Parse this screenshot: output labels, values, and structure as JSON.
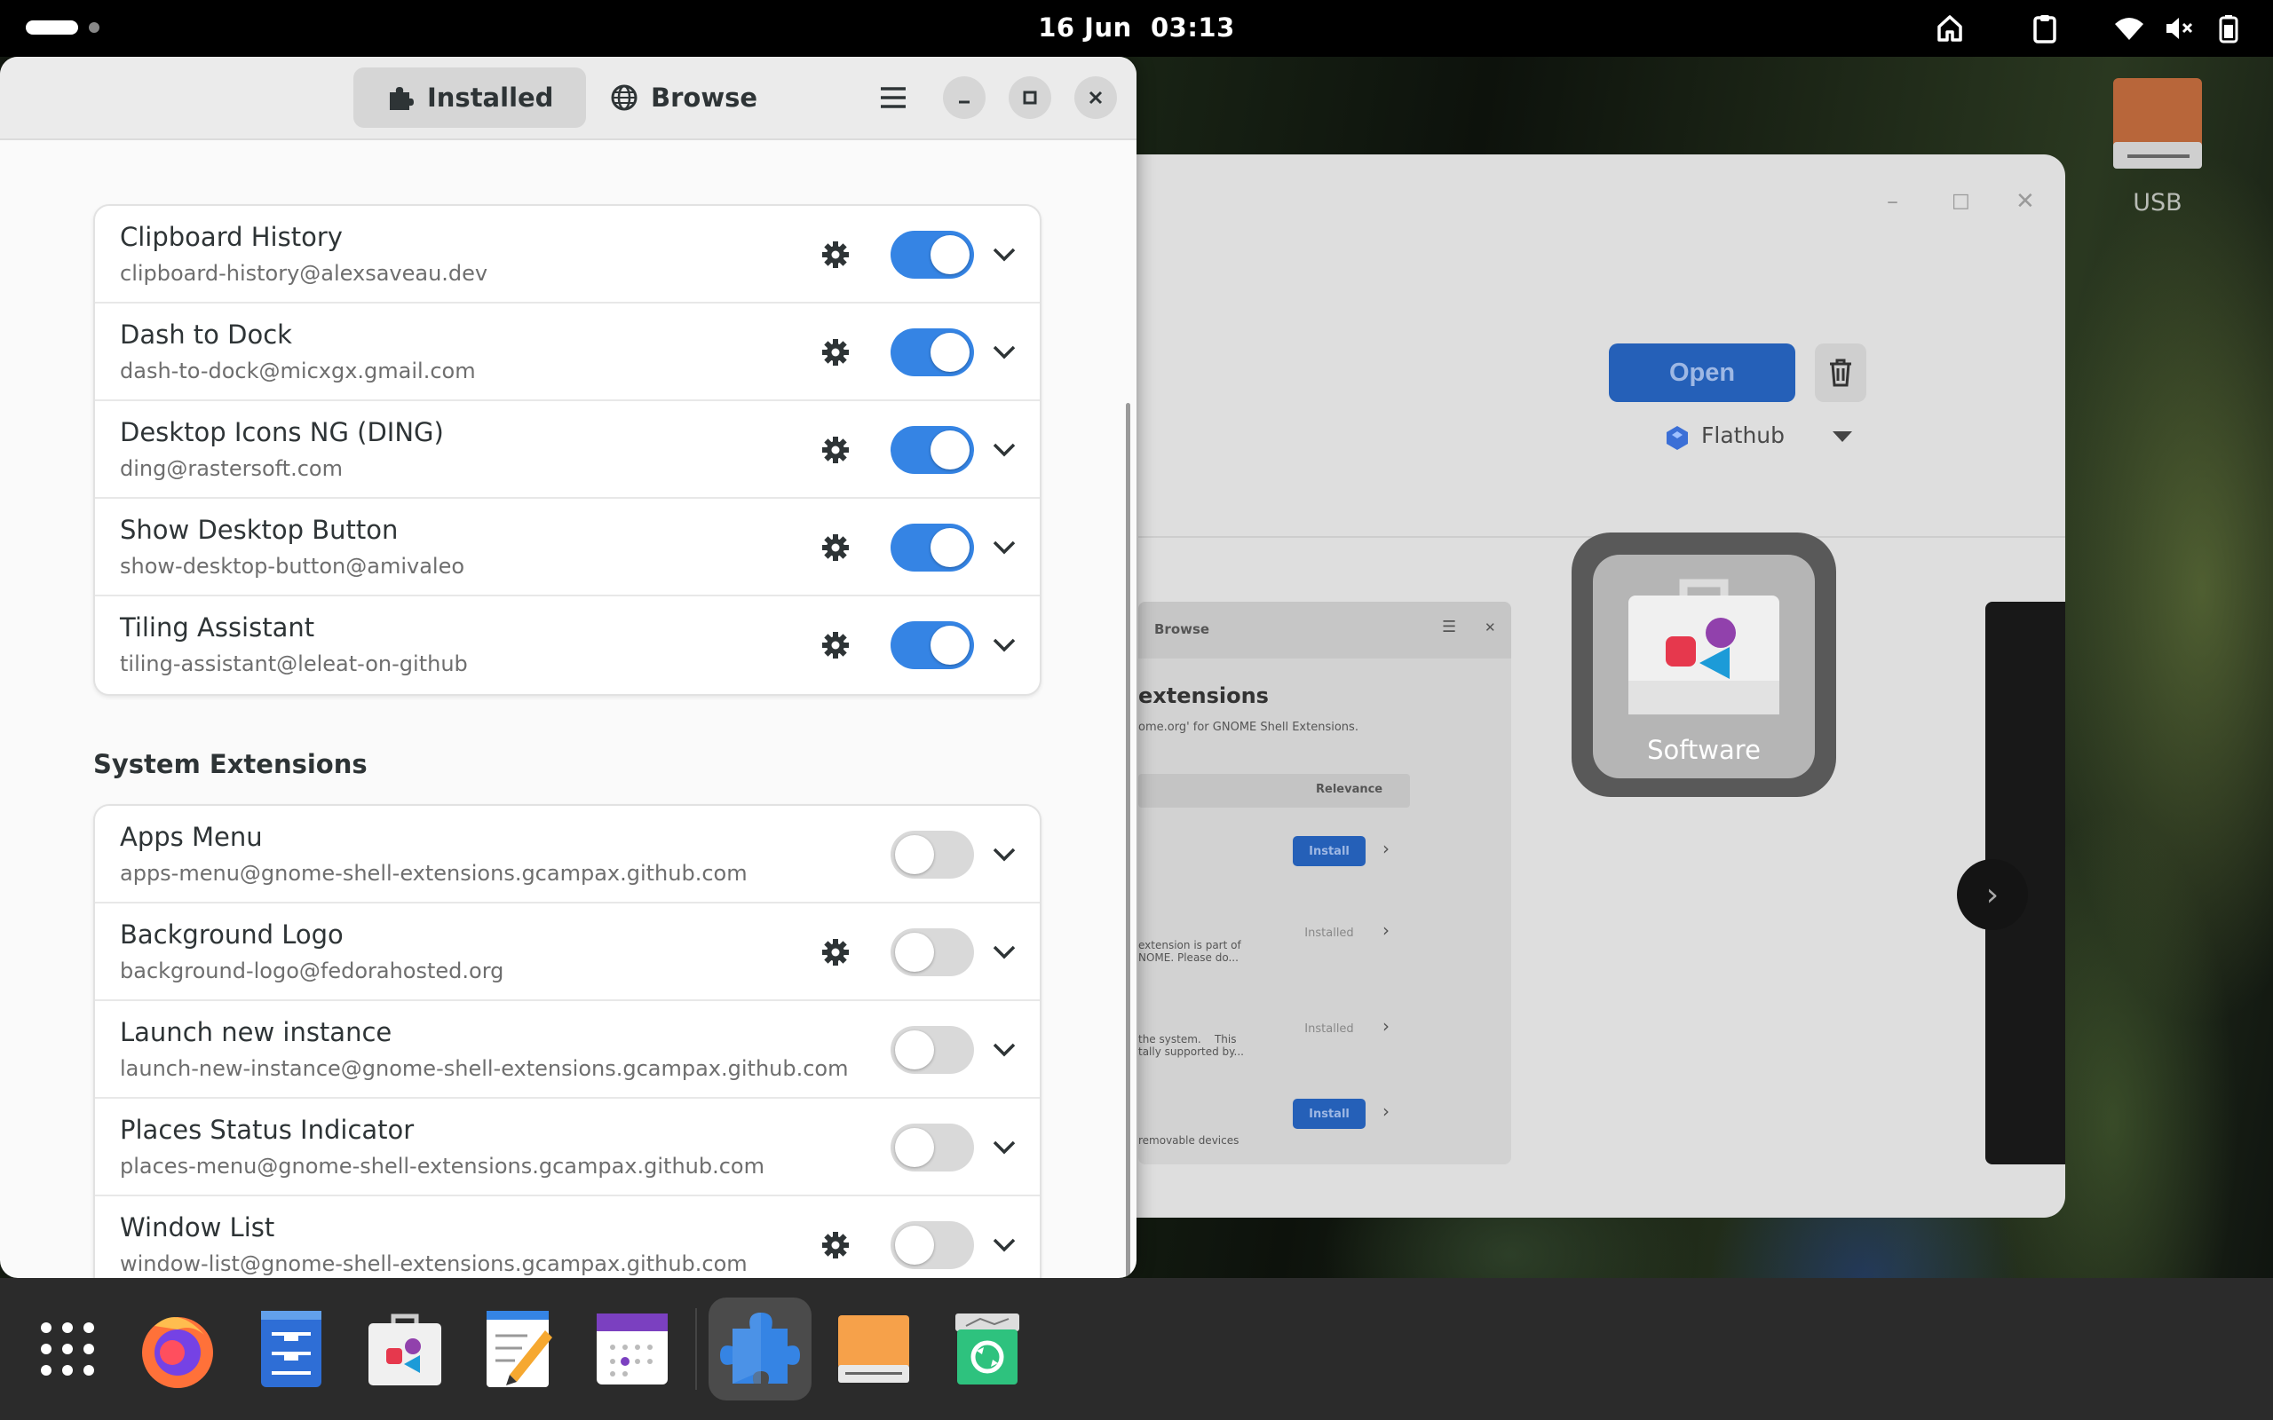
{
  "top_bar": {
    "date": "16 Jun",
    "time": "03:13"
  },
  "desktop": {
    "usb_label": "USB"
  },
  "background_window": {
    "app": "Software",
    "open_label": "Open",
    "source_label": "Flathub",
    "screenshot": {
      "tab_label": "Browse",
      "title_fragment": "extensions",
      "subtitle_fragment": "ome.org' for GNOME Shell Extensions.",
      "sort_label": "Relevance",
      "rows": [
        {
          "button": "Install",
          "text": ""
        },
        {
          "button": "Installed",
          "text": "extension is part of\nNOME. Please do..."
        },
        {
          "button": "Installed",
          "text": "the system.    This\ntally supported by..."
        },
        {
          "button": "Install",
          "text": "removable devices"
        }
      ]
    }
  },
  "app_tile": {
    "label": "Software"
  },
  "extensions_window": {
    "tabs": [
      {
        "label": "Installed",
        "icon": "puzzle-icon",
        "active": true
      },
      {
        "label": "Browse",
        "icon": "globe-icon",
        "active": false
      }
    ],
    "user_extensions": [
      {
        "title": "Clipboard History",
        "uuid": "clipboard-history@alexsaveau.dev",
        "has_settings": true,
        "enabled": true
      },
      {
        "title": "Dash to Dock",
        "uuid": "dash-to-dock@micxgx.gmail.com",
        "has_settings": true,
        "enabled": true
      },
      {
        "title": "Desktop Icons NG (DING)",
        "uuid": "ding@rastersoft.com",
        "has_settings": true,
        "enabled": true
      },
      {
        "title": "Show Desktop Button",
        "uuid": "show-desktop-button@amivaleo",
        "has_settings": true,
        "enabled": true
      },
      {
        "title": "Tiling Assistant",
        "uuid": "tiling-assistant@leleat-on-github",
        "has_settings": true,
        "enabled": true
      }
    ],
    "system_heading": "System Extensions",
    "system_extensions": [
      {
        "title": "Apps Menu",
        "uuid": "apps-menu@gnome-shell-extensions.gcampax.github.com",
        "has_settings": false,
        "enabled": false
      },
      {
        "title": "Background Logo",
        "uuid": "background-logo@fedorahosted.org",
        "has_settings": true,
        "enabled": false
      },
      {
        "title": "Launch new instance",
        "uuid": "launch-new-instance@gnome-shell-extensions.gcampax.github.com",
        "has_settings": false,
        "enabled": false
      },
      {
        "title": "Places Status Indicator",
        "uuid": "places-menu@gnome-shell-extensions.gcampax.github.com",
        "has_settings": false,
        "enabled": false
      },
      {
        "title": "Window List",
        "uuid": "window-list@gnome-shell-extensions.gcampax.github.com",
        "has_settings": true,
        "enabled": false
      }
    ]
  },
  "dock": {
    "items": [
      {
        "name": "app-grid-icon",
        "running": false
      },
      {
        "name": "firefox-icon",
        "running": false
      },
      {
        "name": "files-icon",
        "running": false
      },
      {
        "name": "software-icon",
        "running": false
      },
      {
        "name": "text-editor-icon",
        "running": false
      },
      {
        "name": "calendar-icon",
        "running": false
      },
      {
        "name": "extensions-icon",
        "running": true
      },
      {
        "name": "usb-drive-icon",
        "running": false
      },
      {
        "name": "trash-icon",
        "running": false
      }
    ]
  },
  "colors": {
    "accent": "#3584e4",
    "switch_off": "#d9d9d9",
    "window_bg": "#fafafa",
    "top_bar": "#000000",
    "dock": "#2b2b2b"
  }
}
